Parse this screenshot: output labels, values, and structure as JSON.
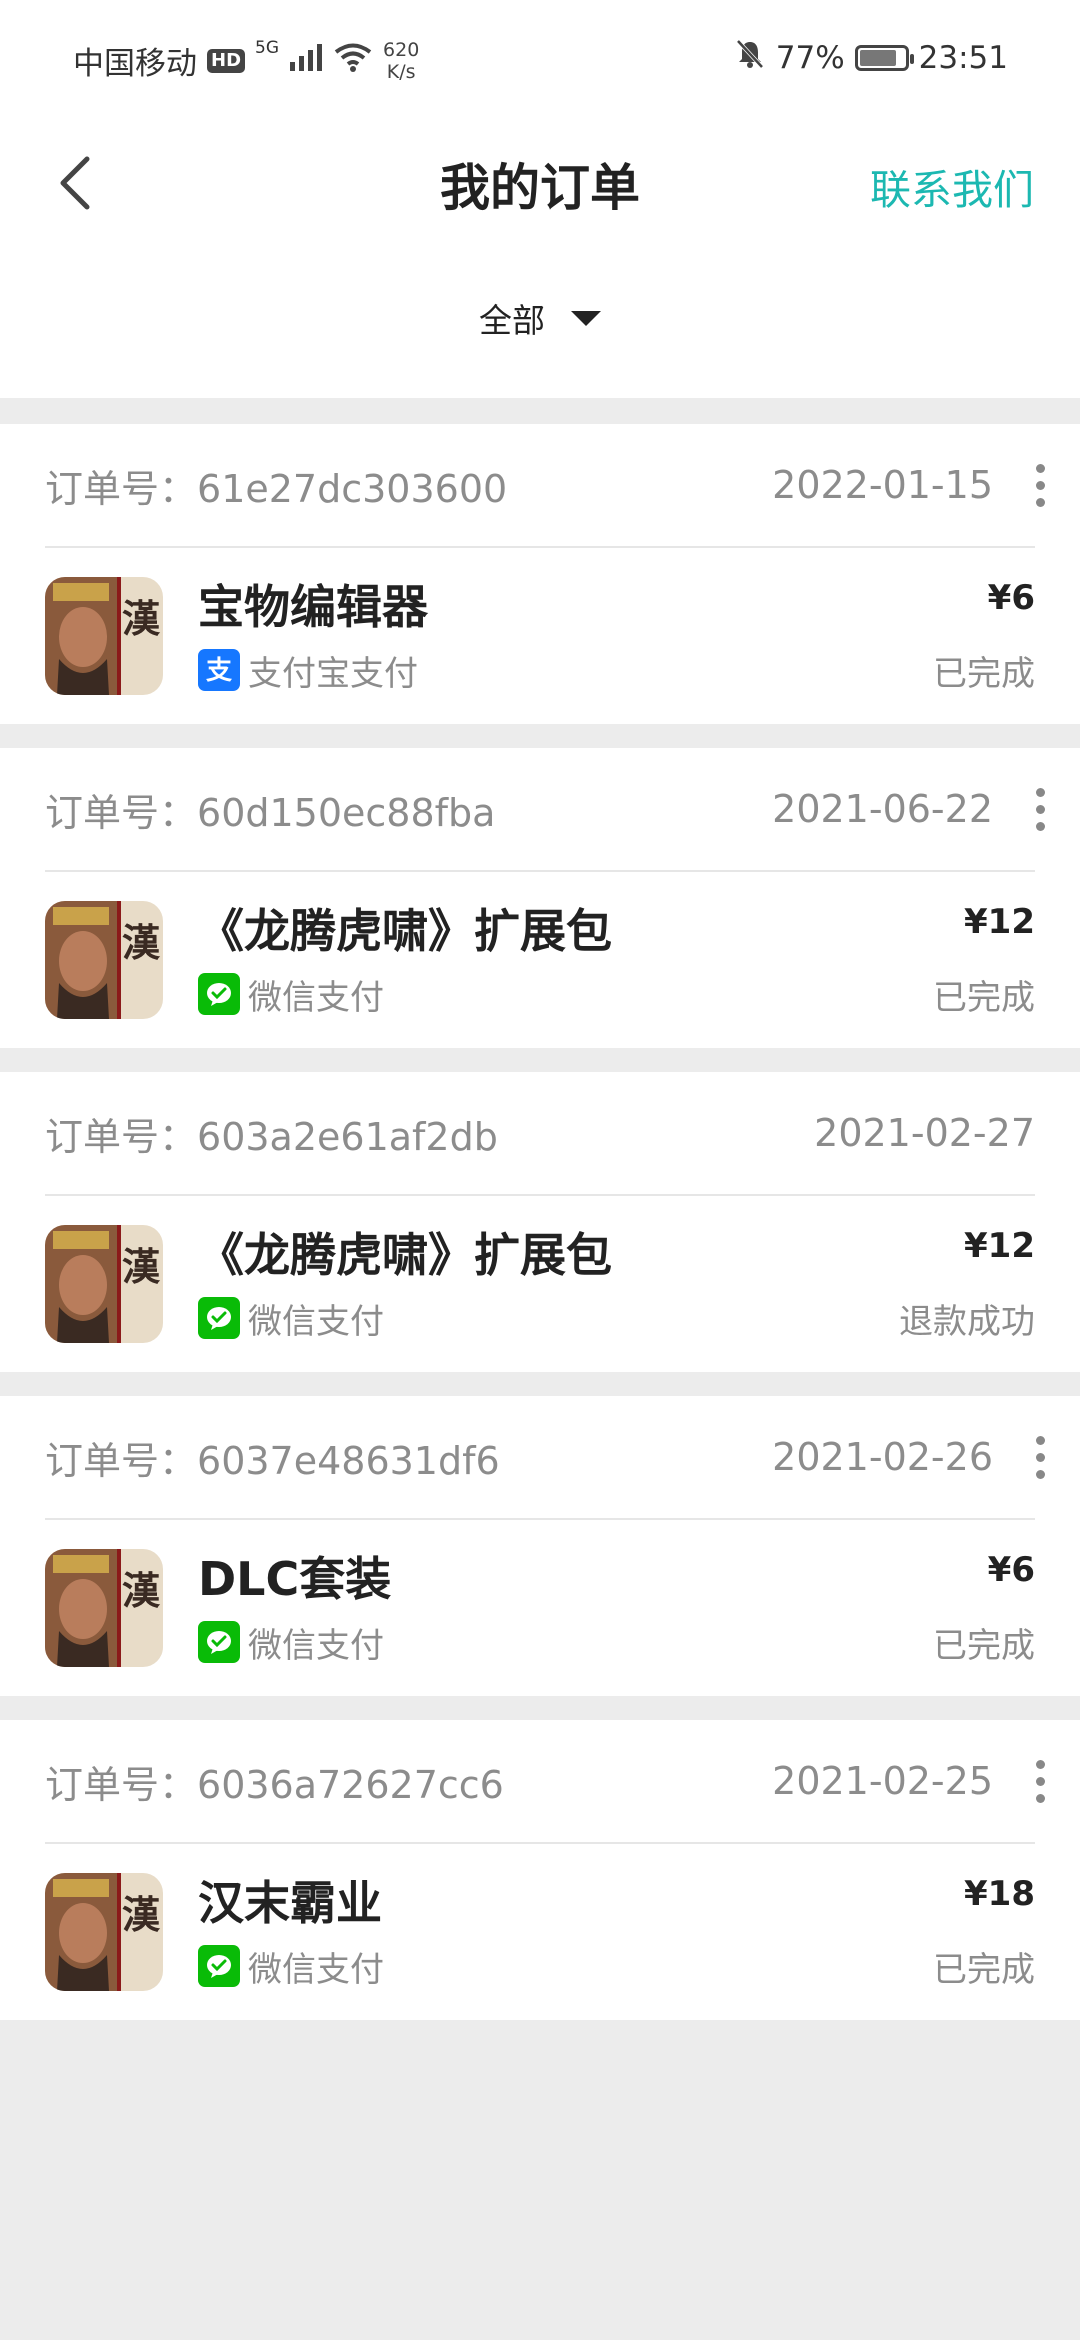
{
  "status_bar": {
    "carrier": "中国移动",
    "hd": "HD",
    "network": "5G",
    "speed_value": "620",
    "speed_unit": "K/s",
    "battery": "77%",
    "time": "23:51"
  },
  "header": {
    "title": "我的订单",
    "contact": "联系我们"
  },
  "filter": {
    "label": "全部"
  },
  "order_label": "订单号：",
  "orders": [
    {
      "id": "61e27dc303600",
      "date": "2022-01-15",
      "name": "宝物编辑器",
      "payment": "支付宝支付",
      "pay_icon": "alipay-icon",
      "price": "¥6",
      "status": "已完成"
    },
    {
      "id": "60d150ec88fba",
      "date": "2021-06-22",
      "name": "《龙腾虎啸》扩展包",
      "payment": "微信支付",
      "pay_icon": "wechat-pay-icon",
      "price": "¥12",
      "status": "已完成"
    },
    {
      "id": "603a2e61af2db",
      "date": "2021-02-27",
      "name": "《龙腾虎啸》扩展包",
      "payment": "微信支付",
      "pay_icon": "wechat-pay-icon",
      "price": "¥12",
      "status": "退款成功"
    },
    {
      "id": "6037e48631df6",
      "date": "2021-02-26",
      "name": "DLC套装",
      "payment": "微信支付",
      "pay_icon": "wechat-pay-icon",
      "price": "¥6",
      "status": "已完成"
    },
    {
      "id": "6036a72627cc6",
      "date": "2021-02-25",
      "name": "汉末霸业",
      "payment": "微信支付",
      "pay_icon": "wechat-pay-icon",
      "price": "¥18",
      "status": "已完成"
    }
  ],
  "colors": {
    "accent": "#1cb8b1",
    "alipay": "#1677ff",
    "wechat": "#09bb07",
    "muted_text": "#8c8c8c",
    "background": "#ececec"
  }
}
